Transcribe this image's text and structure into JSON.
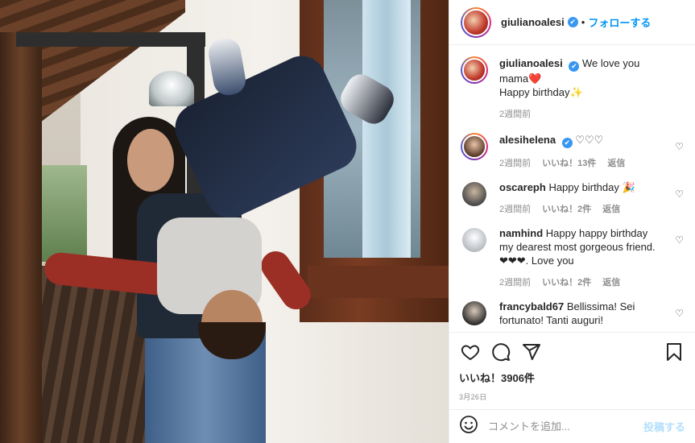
{
  "header": {
    "username": "giulianoalesi",
    "verified_mark": "✔",
    "separator": "•",
    "follow_label": "フォローする"
  },
  "caption": {
    "username": "giulianoalesi",
    "text_line1": "We love you mama❤️",
    "text_line2": "Happy birthday✨",
    "time": "2週間前"
  },
  "comments": [
    {
      "username": "alesihelena",
      "verified": true,
      "text": "♡♡♡",
      "time": "2週間前",
      "likes": "いいね！13件",
      "reply": "返信"
    },
    {
      "username": "oscareph",
      "verified": false,
      "text": "Happy birthday 🎉",
      "time": "2週間前",
      "likes": "いいね！2件",
      "reply": "返信"
    },
    {
      "username": "namhind",
      "verified": false,
      "text": "Happy happy birthday my dearest most gorgeous friend. ❤❤❤. Love you",
      "time": "2週間前",
      "likes": "いいね！2件",
      "reply": "返信"
    },
    {
      "username": "francybald67",
      "verified": false,
      "text": "Bellissima! Sei fortunato! Tanti auguri!",
      "time": "",
      "likes": "",
      "reply": ""
    }
  ],
  "actions": {
    "like_icon": "heart-icon",
    "comment_icon": "comment-icon",
    "share_icon": "share-icon",
    "save_icon": "bookmark-icon",
    "likes_text": "いいね！3906件",
    "date": "3月26日"
  },
  "add_comment": {
    "placeholder": "コメントを追加...",
    "post_label": "投稿する"
  },
  "colors": {
    "link_blue": "#0095f6",
    "verified_blue": "#3897f0",
    "muted": "#8e8e8e",
    "post_disabled": "#b2dffc"
  }
}
